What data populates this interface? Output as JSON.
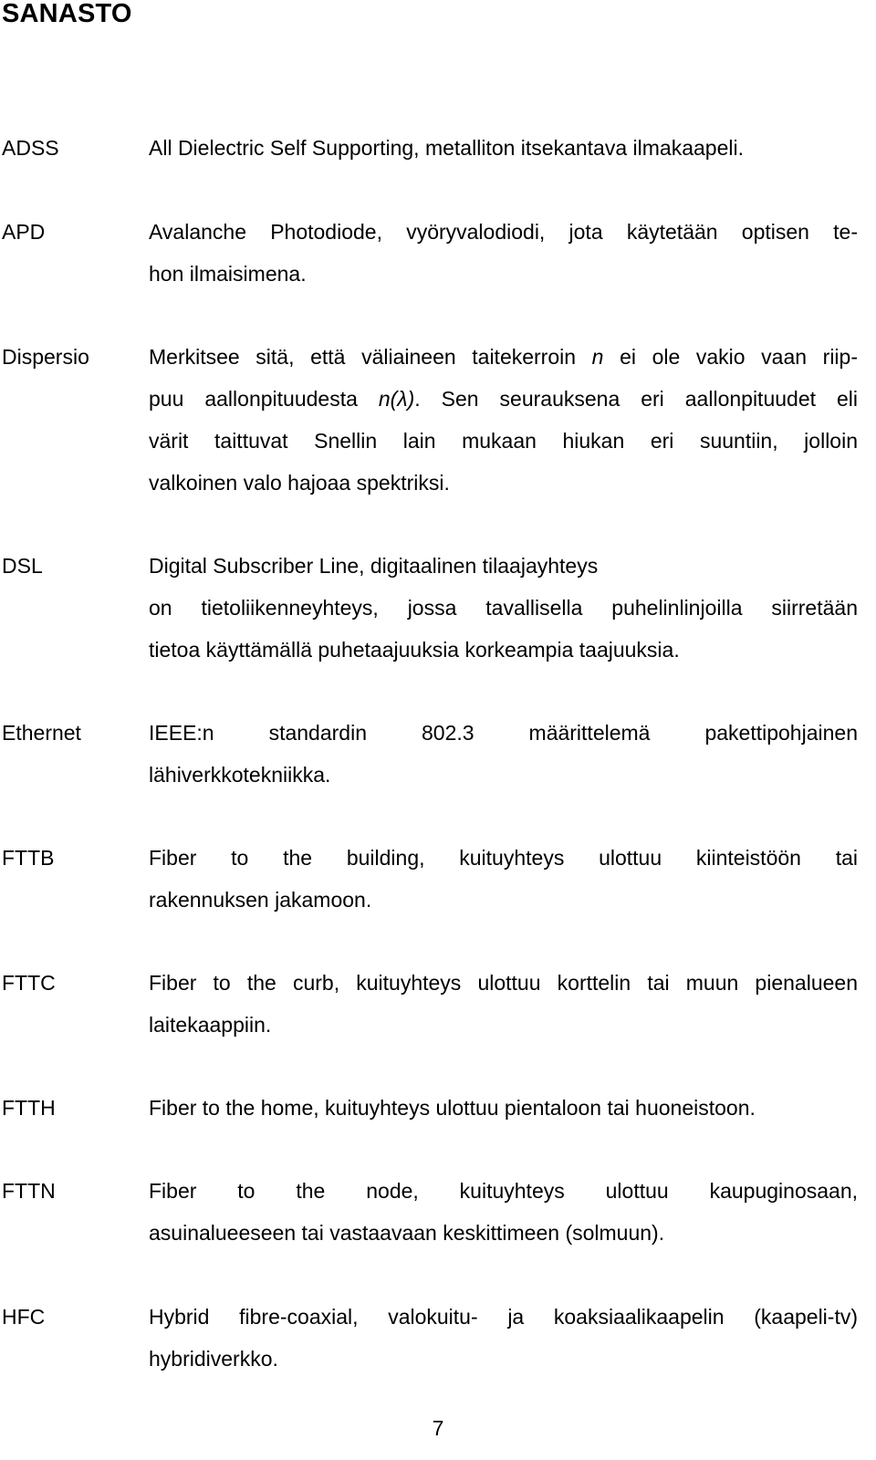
{
  "document": {
    "title": "SANASTO",
    "page_number": "7",
    "entries": [
      {
        "term": "ADSS",
        "lines": [
          "All Dielectric Self Supporting, metalliton itsekantava ilmakaapeli."
        ]
      },
      {
        "term": "APD",
        "lines": [
          "Avalanche Photodiode, vyöryvalodiodi, jota käytetään optisen te-",
          "hon ilmaisimena."
        ]
      },
      {
        "term": "Dispersio",
        "line1_pre": "Merkitsee sitä, että väliaineen taitekerroin ",
        "line1_italic": "n",
        "line1_post": " ei ole vakio vaan riip-",
        "line2_pre": "puu aallonpituudesta ",
        "line2_italic": "n(λ)",
        "line2_post": ". Sen seurauksena eri aallonpituudet eli",
        "line3": "värit taittuvat Snellin lain mukaan hiukan eri suuntiin, jolloin",
        "line4": "valkoinen valo hajoaa spektriksi."
      },
      {
        "term": "DSL",
        "lines": [
          "Digital Subscriber Line, digitaalinen tilaajayhteys",
          "on tietoliikenneyhteys, jossa tavallisella puhelinlinjoilla siirretään",
          "tietoa käyttämällä puhetaajuuksia korkeampia taajuuksia."
        ]
      },
      {
        "term": "Ethernet",
        "lines": [
          "IEEE:n standardin 802.3 määrittelemä pakettipohjainen",
          "lähiverkkotekniikka."
        ]
      },
      {
        "term": "FTTB",
        "lines": [
          "Fiber to the building, kuituyhteys ulottuu kiinteistöön tai",
          "rakennuksen jakamoon."
        ]
      },
      {
        "term": "FTTC",
        "lines": [
          "Fiber to the curb, kuituyhteys ulottuu korttelin tai muun pienalueen",
          "laitekaappiin."
        ]
      },
      {
        "term": "FTTH",
        "lines": [
          "Fiber to the home, kuituyhteys ulottuu pientaloon tai huoneistoon."
        ]
      },
      {
        "term": "FTTN",
        "lines": [
          "Fiber to the node, kuituyhteys ulottuu kaupuginosaan,",
          "asuinalueeseen tai vastaavaan keskittimeen (solmuun)."
        ]
      },
      {
        "term": "HFC",
        "lines": [
          "Hybrid fibre-coaxial, valokuitu- ja koaksiaalikaapelin (kaapeli-tv)",
          "hybridiverkko."
        ]
      }
    ]
  }
}
